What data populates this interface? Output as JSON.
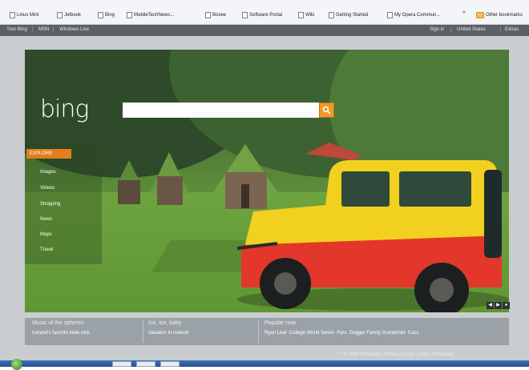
{
  "bookmarks": [
    {
      "label": "Linux Mint",
      "icon": "page-icon"
    },
    {
      "label": "Jetbook",
      "icon": "page-icon"
    },
    {
      "label": "Bing",
      "icon": "page-icon"
    },
    {
      "label": "MobileTechNews...",
      "icon": "page-icon"
    },
    {
      "label": "Boxee",
      "icon": "page-icon"
    },
    {
      "label": "Software Portal",
      "icon": "page-icon"
    },
    {
      "label": "Wiki",
      "icon": "page-icon"
    },
    {
      "label": "Getting Started",
      "icon": "page-icon"
    },
    {
      "label": "My Opera Commun...",
      "icon": "page-icon"
    },
    {
      "label": "Other bookmarks",
      "icon": "folder-icon"
    }
  ],
  "topbar": {
    "left": [
      "Your Bing",
      "MSN",
      "Windows Live"
    ],
    "right": [
      "Sign in",
      "United States",
      "Extras"
    ]
  },
  "logo": "bing",
  "search": {
    "value": "",
    "placeholder": ""
  },
  "nav": {
    "active": "EXPLORE",
    "items": [
      "Images",
      "Videos",
      "Shopping",
      "News",
      "Maps",
      "Travel"
    ]
  },
  "footer": {
    "col1": {
      "heading": "Music of the spheres",
      "text": "Iceland's favorite indie rock"
    },
    "col2": {
      "heading": "Ice, ice, baby",
      "text": "Vacation in Iceland"
    },
    "col3": {
      "heading": "Popular now",
      "items": [
        "Ryan Leaf",
        "College World Series",
        "Pyro",
        "Dogger Family Grandchild",
        "Kazz"
      ]
    },
    "copyright": "© 2009 Microsoft | Privacy | Legal | Help | Feedback"
  },
  "colors": {
    "accent": "#e27f1c",
    "topbar": "#5a6066",
    "footer": "#9aa2a8"
  }
}
